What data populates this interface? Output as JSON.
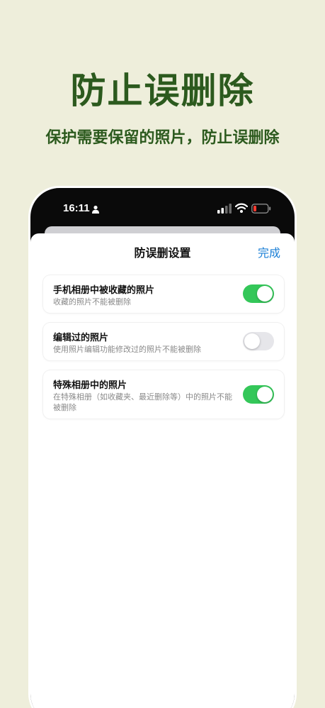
{
  "promo": {
    "headline": "防止误删除",
    "subline": "保护需要保留的照片，防止误删除"
  },
  "status_bar": {
    "time": "16:11",
    "icons": [
      "person-icon",
      "signal-icon",
      "wifi-icon",
      "battery-icon"
    ]
  },
  "sheet": {
    "title": "防误删设置",
    "done_label": "完成"
  },
  "settings": [
    {
      "title": "手机相册中被收藏的照片",
      "subtitle": "收藏的照片不能被删除",
      "enabled": true
    },
    {
      "title": "编辑过的照片",
      "subtitle": "使用照片编辑功能修改过的照片不能被删除",
      "enabled": false
    },
    {
      "title": "特殊相册中的照片",
      "subtitle": "在特殊相册（如收藏夹、最近删除等）中的照片不能被删除",
      "enabled": true
    }
  ],
  "colors": {
    "background": "#eeeedb",
    "headline": "#2c5a1e",
    "accent_blue": "#1a7fd6",
    "toggle_on": "#34c759",
    "toggle_off": "#e6e6ea"
  }
}
